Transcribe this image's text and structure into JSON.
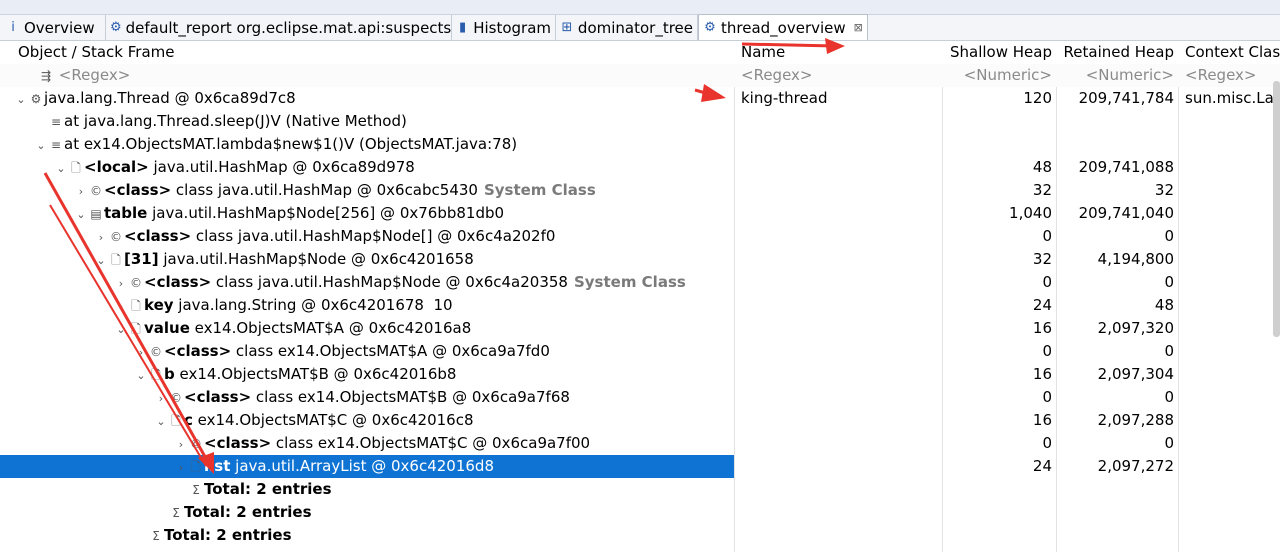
{
  "tabs": [
    {
      "label": "Overview",
      "icon": "info-icon",
      "glyph": "i"
    },
    {
      "label": "default_report  org.eclipse.mat.api:suspects",
      "icon": "report-icon",
      "glyph": "⚙"
    },
    {
      "label": "Histogram",
      "icon": "histogram-icon",
      "glyph": "▮"
    },
    {
      "label": "dominator_tree",
      "icon": "tree-icon",
      "glyph": "⊞"
    },
    {
      "label": "thread_overview",
      "icon": "thread-icon",
      "glyph": "⚙",
      "close": "⊠"
    }
  ],
  "columns": {
    "object": "Object / Stack Frame",
    "name": "Name",
    "shallow": "Shallow Heap",
    "retained": "Retained Heap",
    "context": "Context Clas"
  },
  "filter": {
    "object": "<Regex>",
    "name": "<Regex>",
    "shallow": "<Numeric>",
    "retained": "<Numeric>",
    "context": "<Regex>"
  },
  "rows": [
    {
      "indent": 0,
      "tw": "⌄",
      "icon": "thread-icon",
      "glyph": "⚙",
      "bold": "",
      "text": "java.lang.Thread @ 0x6ca89d7c8",
      "sys": "",
      "name": "king-thread",
      "shallow": "120",
      "retained": "209,741,784",
      "context": "sun.misc.Lau"
    },
    {
      "indent": 1,
      "tw": "",
      "icon": "stack-frame-icon",
      "glyph": "≡",
      "bold": "",
      "text": "at java.lang.Thread.sleep(J)V (Native Method)",
      "sys": "",
      "name": "",
      "shallow": "",
      "retained": "",
      "context": ""
    },
    {
      "indent": 1,
      "tw": "⌄",
      "icon": "stack-frame-icon",
      "glyph": "≡",
      "bold": "",
      "text": "at ex14.ObjectsMAT.lambda$new$1()V (ObjectsMAT.java:78)",
      "sys": "",
      "name": "",
      "shallow": "",
      "retained": "",
      "context": ""
    },
    {
      "indent": 2,
      "tw": "⌄",
      "icon": "object-icon",
      "glyph": "🗋",
      "bold": "<local>",
      "text": " java.util.HashMap @ 0x6ca89d978",
      "sys": "",
      "name": "",
      "shallow": "48",
      "retained": "209,741,088",
      "context": ""
    },
    {
      "indent": 3,
      "tw": "›",
      "icon": "class-icon",
      "glyph": "©",
      "bold": "<class>",
      "text": " class java.util.HashMap @ 0x6cabc5430",
      "sys": "System Class",
      "name": "",
      "shallow": "32",
      "retained": "32",
      "context": ""
    },
    {
      "indent": 3,
      "tw": "⌄",
      "icon": "array-icon",
      "glyph": "▤",
      "bold": "table",
      "text": " java.util.HashMap$Node[256] @ 0x76bb81db0",
      "sys": "",
      "name": "",
      "shallow": "1,040",
      "retained": "209,741,040",
      "context": ""
    },
    {
      "indent": 4,
      "tw": "›",
      "icon": "class-icon",
      "glyph": "©",
      "bold": "<class>",
      "text": " class java.util.HashMap$Node[] @ 0x6c4a202f0",
      "sys": "",
      "name": "",
      "shallow": "0",
      "retained": "0",
      "context": ""
    },
    {
      "indent": 4,
      "tw": "⌄",
      "icon": "object-icon",
      "glyph": "🗋",
      "bold": "[31]",
      "text": " java.util.HashMap$Node @ 0x6c4201658",
      "sys": "",
      "name": "",
      "shallow": "32",
      "retained": "4,194,800",
      "context": ""
    },
    {
      "indent": 5,
      "tw": "›",
      "icon": "class-icon",
      "glyph": "©",
      "bold": "<class>",
      "text": " class java.util.HashMap$Node @ 0x6c4a20358",
      "sys": "System Class",
      "name": "",
      "shallow": "0",
      "retained": "0",
      "context": ""
    },
    {
      "indent": 5,
      "tw": "›",
      "icon": "object-icon",
      "glyph": "🗋",
      "bold": "key",
      "text": " java.lang.String @ 0x6c4201678  10",
      "sys": "",
      "name": "",
      "shallow": "24",
      "retained": "48",
      "context": ""
    },
    {
      "indent": 5,
      "tw": "⌄",
      "icon": "object-icon",
      "glyph": "🗋",
      "bold": "value",
      "text": " ex14.ObjectsMAT$A @ 0x6c42016a8",
      "sys": "",
      "name": "",
      "shallow": "16",
      "retained": "2,097,320",
      "context": ""
    },
    {
      "indent": 6,
      "tw": "›",
      "icon": "class-icon",
      "glyph": "©",
      "bold": "<class>",
      "text": " class ex14.ObjectsMAT$A @ 0x6ca9a7fd0",
      "sys": "",
      "name": "",
      "shallow": "0",
      "retained": "0",
      "context": ""
    },
    {
      "indent": 6,
      "tw": "⌄",
      "icon": "object-icon",
      "glyph": "🗋",
      "bold": "b",
      "text": " ex14.ObjectsMAT$B @ 0x6c42016b8",
      "sys": "",
      "name": "",
      "shallow": "16",
      "retained": "2,097,304",
      "context": ""
    },
    {
      "indent": 7,
      "tw": "›",
      "icon": "class-icon",
      "glyph": "©",
      "bold": "<class>",
      "text": " class ex14.ObjectsMAT$B @ 0x6ca9a7f68",
      "sys": "",
      "name": "",
      "shallow": "0",
      "retained": "0",
      "context": ""
    },
    {
      "indent": 7,
      "tw": "⌄",
      "icon": "object-icon",
      "glyph": "🗋",
      "bold": "c",
      "text": " ex14.ObjectsMAT$C @ 0x6c42016c8",
      "sys": "",
      "name": "",
      "shallow": "16",
      "retained": "2,097,288",
      "context": ""
    },
    {
      "indent": 8,
      "tw": "›",
      "icon": "class-icon",
      "glyph": "©",
      "bold": "<class>",
      "text": " class ex14.ObjectsMAT$C @ 0x6ca9a7f00",
      "sys": "",
      "name": "",
      "shallow": "0",
      "retained": "0",
      "context": ""
    },
    {
      "indent": 8,
      "tw": "›",
      "icon": "object-icon",
      "glyph": "🗋",
      "bold": "list",
      "text": " java.util.ArrayList @ 0x6c42016d8",
      "sys": "",
      "name": "",
      "shallow": "24",
      "retained": "2,097,272",
      "context": "",
      "selected": true
    },
    {
      "indent": 8,
      "tw": "",
      "icon": "sum-icon",
      "glyph": "Σ",
      "bold": "Total: 2 entries",
      "text": "",
      "sys": "",
      "name": "",
      "shallow": "",
      "retained": "",
      "context": ""
    },
    {
      "indent": 7,
      "tw": "",
      "icon": "sum-icon",
      "glyph": "Σ",
      "bold": "Total: 2 entries",
      "text": "",
      "sys": "",
      "name": "",
      "shallow": "",
      "retained": "",
      "context": ""
    },
    {
      "indent": 6,
      "tw": "",
      "icon": "sum-icon",
      "glyph": "Σ",
      "bold": "Total: 2 entries",
      "text": "",
      "sys": "",
      "name": "",
      "shallow": "",
      "retained": "",
      "context": ""
    }
  ],
  "colors": {
    "selection": "#0f73d4",
    "annotation": "#e8342c"
  }
}
